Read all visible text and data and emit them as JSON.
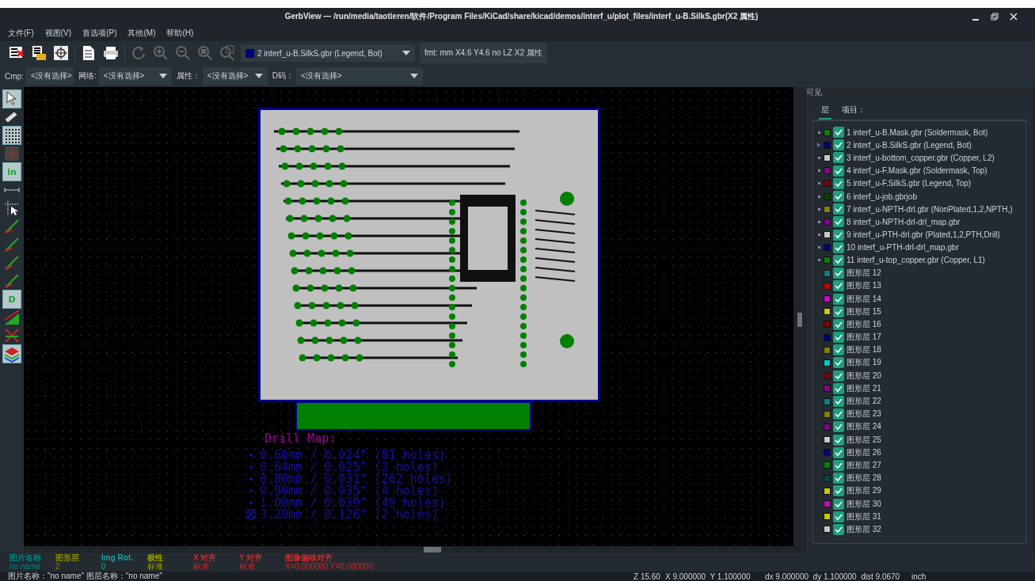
{
  "window": {
    "title": "GerbView — /run/media/taotieren/软件/Program Files/KiCad/share/kicad/demos/interf_u/plot_files/interf_u-B.SilkS.gbr(X2 属性)"
  },
  "menu": [
    "文件(F)",
    "视图(V)",
    "首选项(P)",
    "其他(M)",
    "帮助(H)"
  ],
  "toolbar": {
    "layer_select": {
      "value": "2 interf_u-B.SilkS.gbr (Legend, Bot)",
      "color": "#000080"
    },
    "format_info": "fmt: mm X4.6 Y4.6 no LZ X2 属性"
  },
  "filters": [
    {
      "label": "Cmp:",
      "value": "<没有选择>"
    },
    {
      "label": "网络:",
      "value": "<没有选择>"
    },
    {
      "label": "属性：",
      "value": "<没有选择>"
    },
    {
      "label": "D码：",
      "value": "<没有选择>"
    }
  ],
  "tools": [
    {
      "kind": "arrow",
      "on": true
    },
    {
      "kind": "measure",
      "on": false
    },
    {
      "kind": "grid",
      "on": true
    },
    {
      "kind": "polar",
      "on": false
    },
    {
      "kind": "units",
      "on": true,
      "label": "in"
    },
    {
      "kind": "ruler",
      "on": false
    },
    {
      "kind": "cursor",
      "on": false
    },
    {
      "kind": "line",
      "on": false
    },
    {
      "kind": "line",
      "on": false
    },
    {
      "kind": "line",
      "on": false
    },
    {
      "kind": "line",
      "on": false
    },
    {
      "kind": "dcode",
      "on": true,
      "label": "D"
    },
    {
      "kind": "fill",
      "on": false
    },
    {
      "kind": "negative",
      "on": false
    },
    {
      "kind": "layers",
      "on": true
    }
  ],
  "drill_map": {
    "title": "Drill Map:",
    "rows": [
      {
        "kind": "dot",
        "text": "0.60mm / 0.024\" (81 holes)"
      },
      {
        "kind": "dot",
        "text": "0.64mm / 0.025\" (3 holes)"
      },
      {
        "kind": "dot",
        "text": "0.80mm / 0.031\" (262 holes)"
      },
      {
        "kind": "dot",
        "text": "0.90mm / 0.035\" (4 holes)"
      },
      {
        "kind": "dot",
        "text": "1.00mm / 0.039\" (49 holes)"
      },
      {
        "kind": "crossed",
        "text": "3.20mm / 0.126\" (2 holes)"
      }
    ]
  },
  "panel": {
    "title": "可见",
    "tabs": [
      {
        "label": "层",
        "selected": true
      },
      {
        "label": "项目：",
        "selected": false
      }
    ],
    "layers": [
      {
        "name": "1 interf_u-B.Mask.gbr (Soldermask, Bot)",
        "color": "#008000",
        "checked": true,
        "loaded": true,
        "selected": false
      },
      {
        "name": "2 interf_u-B.SilkS.gbr (Legend, Bot)",
        "color": "#000080",
        "checked": true,
        "loaded": true,
        "selected": true
      },
      {
        "name": "3 interf_u-bottom_copper.gbr (Copper, L2)",
        "color": "#c8c8c8",
        "checked": true,
        "loaded": true,
        "selected": false
      },
      {
        "name": "4 interf_u-F.Mask.gbr (Soldermask, Top)",
        "color": "#840084",
        "checked": true,
        "loaded": true,
        "selected": false
      },
      {
        "name": "5 interf_u-F.SilkS.gbr (Legend, Top)",
        "color": "#840000",
        "checked": true,
        "loaded": true,
        "selected": false
      },
      {
        "name": "6 interf_u-job.gbrjob",
        "color": "#004800",
        "checked": true,
        "loaded": true,
        "selected": false
      },
      {
        "name": "7 interf_u-NPTH-drl.gbr (NonPlated,1,2,NPTH,)",
        "color": "#848400",
        "checked": true,
        "loaded": true,
        "selected": false
      },
      {
        "name": "8 interf_u-NPTH-drl-drl_map.gbr",
        "color": "#840084",
        "checked": true,
        "loaded": true,
        "selected": false
      },
      {
        "name": "9 interf_u-PTH-drl.gbr (Plated,1,2,PTH,Drill)",
        "color": "#c8c8c8",
        "checked": true,
        "loaded": true,
        "selected": false
      },
      {
        "name": "10 interf_u-PTH-drl-drl_map.gbr",
        "color": "#000084",
        "checked": true,
        "loaded": true,
        "selected": false
      },
      {
        "name": "11 interf_u-top_copper.gbr (Copper, L1)",
        "color": "#008400",
        "checked": true,
        "loaded": true,
        "selected": false
      },
      {
        "name": "图形层 12",
        "color": "#008484",
        "checked": true,
        "loaded": false,
        "selected": false
      },
      {
        "name": "图形层 13",
        "color": "#c80000",
        "checked": true,
        "loaded": false,
        "selected": false
      },
      {
        "name": "图形层 14",
        "color": "#c800c8",
        "checked": true,
        "loaded": false,
        "selected": false
      },
      {
        "name": "图形层 15",
        "color": "#c8c800",
        "checked": true,
        "loaded": false,
        "selected": false
      },
      {
        "name": "图形层 16",
        "color": "#840000",
        "checked": true,
        "loaded": false,
        "selected": false
      },
      {
        "name": "图形层 17",
        "color": "#000084",
        "checked": true,
        "loaded": false,
        "selected": false
      },
      {
        "name": "图形层 18",
        "color": "#848400",
        "checked": true,
        "loaded": false,
        "selected": false
      },
      {
        "name": "图形层 19",
        "color": "#00c8c8",
        "checked": true,
        "loaded": false,
        "selected": false
      },
      {
        "name": "图形层 20",
        "color": "#840000",
        "checked": true,
        "loaded": false,
        "selected": false
      },
      {
        "name": "图形层 21",
        "color": "#840084",
        "checked": true,
        "loaded": false,
        "selected": false
      },
      {
        "name": "图形层 22",
        "color": "#008484",
        "checked": true,
        "loaded": false,
        "selected": false
      },
      {
        "name": "图形层 23",
        "color": "#848400",
        "checked": true,
        "loaded": false,
        "selected": false
      },
      {
        "name": "图形层 24",
        "color": "#840084",
        "checked": true,
        "loaded": false,
        "selected": false
      },
      {
        "name": "图形层 25",
        "color": "#c8c8c8",
        "checked": true,
        "loaded": false,
        "selected": false
      },
      {
        "name": "图形层 26",
        "color": "#000084",
        "checked": true,
        "loaded": false,
        "selected": false
      },
      {
        "name": "图形层 27",
        "color": "#008400",
        "checked": true,
        "loaded": false,
        "selected": false
      },
      {
        "name": "图形层 28",
        "color": "#004848",
        "checked": true,
        "loaded": false,
        "selected": false
      },
      {
        "name": "图形层 29",
        "color": "#c8c800",
        "checked": true,
        "loaded": false,
        "selected": false
      },
      {
        "name": "图形层 30",
        "color": "#c800c8",
        "checked": true,
        "loaded": false,
        "selected": false
      },
      {
        "name": "图形层 31",
        "color": "#c8c800",
        "checked": true,
        "loaded": false,
        "selected": false
      },
      {
        "name": "图形层 32",
        "color": "#c8c8c8",
        "checked": true,
        "loaded": false,
        "selected": false
      }
    ]
  },
  "info": [
    {
      "heading": "图片名称",
      "value": "no name",
      "color": "#008484"
    },
    {
      "heading": "图形层",
      "value": "2",
      "color": "#848400"
    },
    {
      "heading": "Img Rot.",
      "value": "0",
      "color": "#20a0a0"
    },
    {
      "heading": "极性",
      "value": "标准",
      "color": "#a0a000"
    },
    {
      "heading": "X 对齐",
      "value": "标准",
      "color": "#d02828"
    },
    {
      "heading": "Y 对齐",
      "value": "标准",
      "color": "#d02828"
    },
    {
      "heading": "图像偏移对齐",
      "value": "X=0.000000 Y=0.000000",
      "color": "#d02828"
    }
  ],
  "status_bar": {
    "names": "图片名称：\"no name\" 图层名称：\"no name\"",
    "zoom": "Z 15.60",
    "position": "X 9.000000  Y 1.100000",
    "delta": "dx 9.000000  dy 1.100000  dist 9.0670",
    "units": "inch"
  }
}
